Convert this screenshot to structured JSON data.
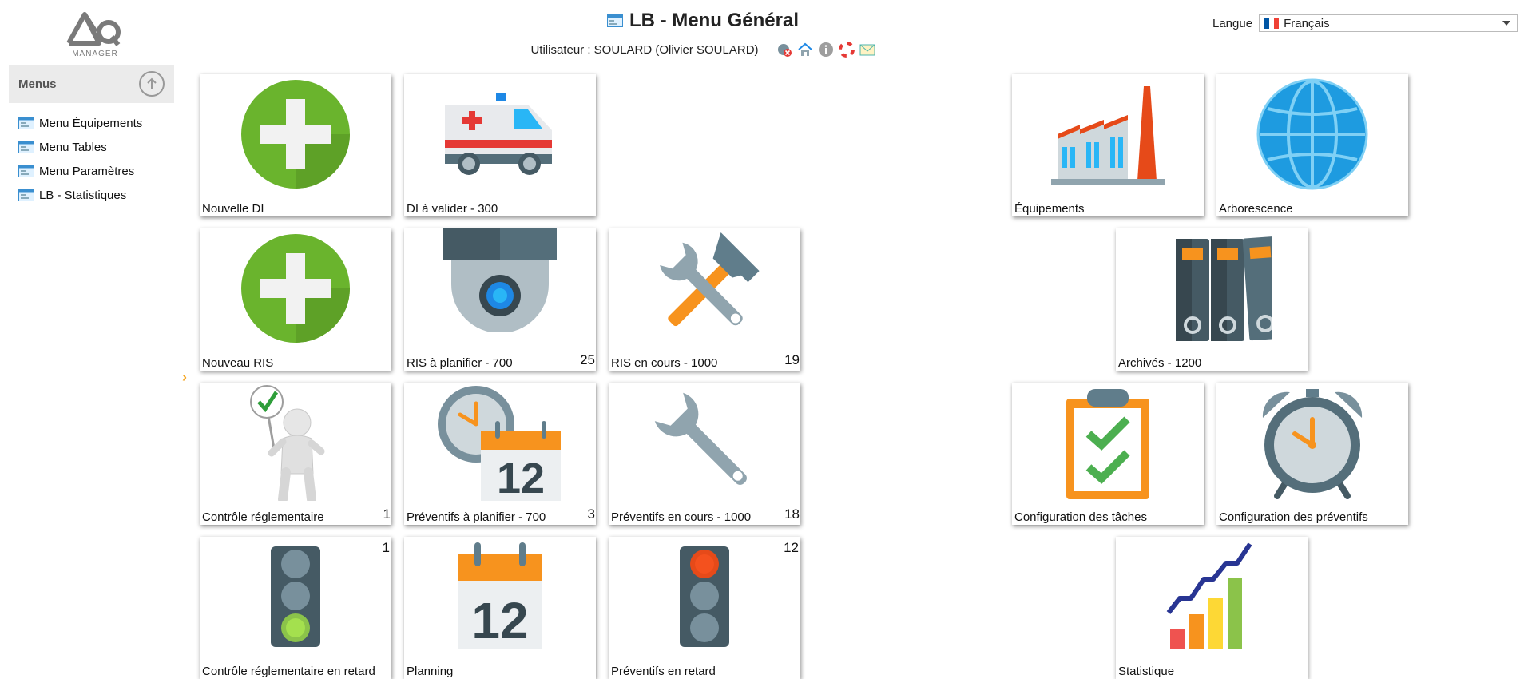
{
  "header": {
    "title": "LB - Menu Général",
    "user_line": "Utilisateur : SOULARD (Olivier SOULARD)",
    "logo_text": "MANAGER",
    "icons": [
      "logout-icon",
      "home-icon",
      "info-icon",
      "help-lifebuoy-icon",
      "mail-icon"
    ]
  },
  "language": {
    "label": "Langue",
    "selected": "Français",
    "flag_colors": [
      "#0055a4",
      "#ffffff",
      "#ef4135"
    ]
  },
  "sidebar": {
    "title": "Menus",
    "items": [
      {
        "label": "Menu Équipements"
      },
      {
        "label": "Menu Tables"
      },
      {
        "label": "Menu Paramètres"
      },
      {
        "label": "LB - Statistiques"
      }
    ]
  },
  "tiles": [
    {
      "label": "Nouvelle DI",
      "icon": "plus-icon"
    },
    {
      "label": "DI à valider - 300",
      "icon": "ambulance-icon"
    },
    {
      "label": "Équipements",
      "icon": "factory-icon"
    },
    {
      "label": "Arborescence",
      "icon": "globe-icon"
    },
    {
      "label": "Nouveau RIS",
      "icon": "plus-icon"
    },
    {
      "label": "RIS à planifier - 700",
      "count": "25",
      "icon": "camera-dome-icon"
    },
    {
      "label": "RIS en cours - 1000",
      "count": "19",
      "icon": "tools-icon"
    },
    {
      "label": "Archivés - 1200",
      "icon": "binders-icon"
    },
    {
      "label": "Contrôle réglementaire",
      "count": "1",
      "icon": "person-check-icon"
    },
    {
      "label": "Préventifs à planifier - 700",
      "count": "3",
      "icon": "clock-calendar-icon"
    },
    {
      "label": "Préventifs en cours - 1000",
      "count": "18",
      "icon": "wrench-icon"
    },
    {
      "label": "Configuration des tâches",
      "icon": "clipboard-check-icon"
    },
    {
      "label": "Configuration des préventifs",
      "icon": "alarm-clock-icon"
    },
    {
      "label": "Contrôle réglementaire en retard",
      "count": "1",
      "icon": "traffic-light-green-icon"
    },
    {
      "label": "Planning",
      "icon": "calendar-icon"
    },
    {
      "label": "Préventifs en retard",
      "count": "12",
      "icon": "traffic-light-red-icon"
    },
    {
      "label": "Statistique",
      "icon": "bar-chart-icon"
    }
  ],
  "calendar_day": "12",
  "colors": {
    "green": "#6ab42d",
    "orange": "#f7931e",
    "slate": "#455a64",
    "blue": "#1e9be0"
  }
}
